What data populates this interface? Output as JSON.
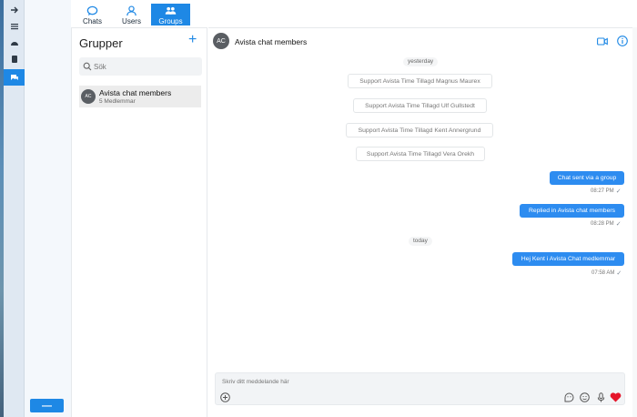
{
  "nav": {
    "tabs": [
      {
        "label": "Chats",
        "icon": "chat-bubble-icon"
      },
      {
        "label": "Users",
        "icon": "user-icon"
      },
      {
        "label": "Groups",
        "icon": "group-icon"
      }
    ],
    "active_tab": "Groups"
  },
  "rail": {
    "items": [
      "arrow-right-icon",
      "list-icon",
      "gauge-icon",
      "book-icon",
      "chat-icon"
    ],
    "active_item": "chat-icon",
    "bottom_button_label": "—"
  },
  "groups_panel": {
    "title": "Grupper",
    "add_icon": "plus-icon",
    "search_placeholder": "Sök",
    "items": [
      {
        "initials": "AC",
        "name": "Avista chat members",
        "subtitle": "5 Medlemmar"
      }
    ]
  },
  "chat": {
    "initials": "AC",
    "title": "Avista chat members",
    "header_icons": [
      "video-camera-icon",
      "info-icon"
    ],
    "day_labels": [
      "yesterday",
      "today"
    ],
    "system_messages": [
      "Support Avista Time Tillagd Magnus Maurex",
      "Support Avista Time Tillagd Ulf Gullstedt",
      "Support Avista Time Tillagd Kent Annergrund",
      "Support Avista Time Tillagd Vera Orekh"
    ],
    "messages": [
      {
        "text": "Chat sent via a group",
        "time": "08:27 PM"
      },
      {
        "text": "Replied in Avista chat members",
        "time": "08:28 PM"
      },
      {
        "text": "Hej Kent i Avista Chat medlemmar",
        "time": "07:58 AM"
      }
    ],
    "check_mark": "✓"
  },
  "composer": {
    "placeholder": "Skriv ditt meddelande här",
    "icons": [
      "add-circle-icon",
      "sticker-icon",
      "emoji-icon",
      "microphone-icon",
      "heart-icon"
    ]
  },
  "colors": {
    "accent": "#1e88e5",
    "bubble": "#2d8cf0",
    "heart": "#e5152a"
  }
}
